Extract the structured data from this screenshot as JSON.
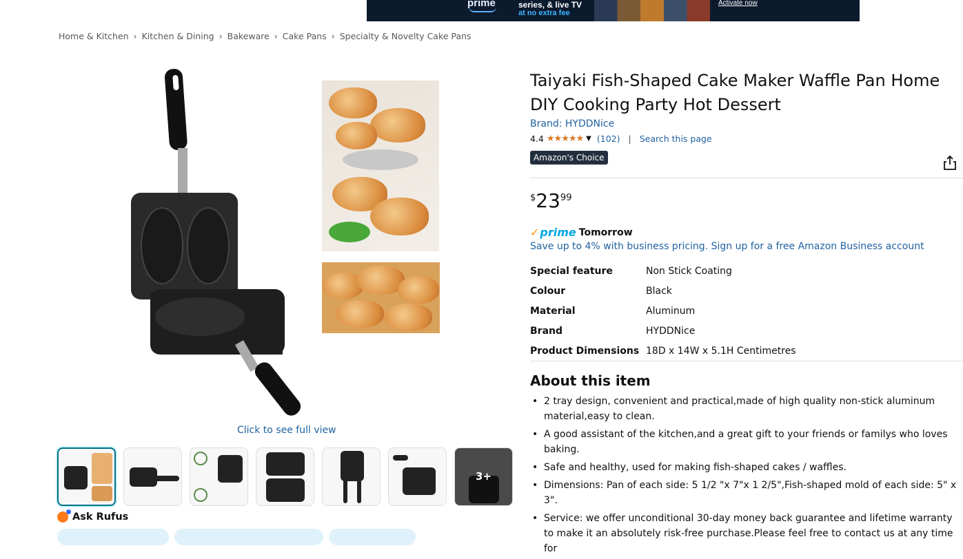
{
  "banner": {
    "prime_text": "prime",
    "line1": "series, & live TV",
    "line2": "at no extra fee",
    "activate": "Activate now"
  },
  "breadcrumbs": [
    "Home & Kitchen",
    "Kitchen & Dining",
    "Bakeware",
    "Cake Pans",
    "Specialty & Novelty Cake Pans"
  ],
  "gallery": {
    "click_full_view": "Click to see full view",
    "more_label": "3+"
  },
  "rufus": {
    "label": "Ask Rufus"
  },
  "product": {
    "title": "Taiyaki Fish-Shaped Cake Maker Waffle Pan Home DIY Cooking Party Hot Dessert",
    "brand": "Brand: HYDDNice",
    "rating": "4.4",
    "stars": "★★★★★",
    "review_count": "(102)",
    "search_page": "Search this page",
    "badge": "Amazon's Choice",
    "price_symbol": "$",
    "price_whole": "23",
    "price_fraction": "99",
    "prime_label": "prime",
    "delivery": "Tomorrow",
    "business": "Save up to 4% with business pricing. Sign up for a free Amazon Business account"
  },
  "specs": [
    {
      "key": "Special feature",
      "value": "Non Stick Coating"
    },
    {
      "key": "Colour",
      "value": "Black"
    },
    {
      "key": "Material",
      "value": "Aluminum"
    },
    {
      "key": "Brand",
      "value": "HYDDNice"
    },
    {
      "key": "Product Dimensions",
      "value": "18D x 14W x 5.1H Centimetres"
    }
  ],
  "about": {
    "heading": "About this item",
    "bullets": [
      "2 tray design, convenient and practical,made of high quality non-stick aluminum material,easy to clean.",
      "A good assistant of the kitchen,and a great gift to your friends or familys who loves baking.",
      "Safe and healthy, used for making fish-shaped cakes / waffles.",
      "Dimensions: Pan of each side: 5 1/2 \"x 7\"x 1 2/5\",Fish-shaped mold of each side: 5\" x 3\".",
      "Service: we offer unconditional 30-day money back guarantee and lifetime warranty to make it an absolutely risk-free purchase.Please feel free to contact us at any time for"
    ]
  },
  "colors": {
    "link": "#2162a1",
    "star": "#de7921",
    "badge_bg": "#232f3e",
    "selected_thumb": "#007185"
  }
}
